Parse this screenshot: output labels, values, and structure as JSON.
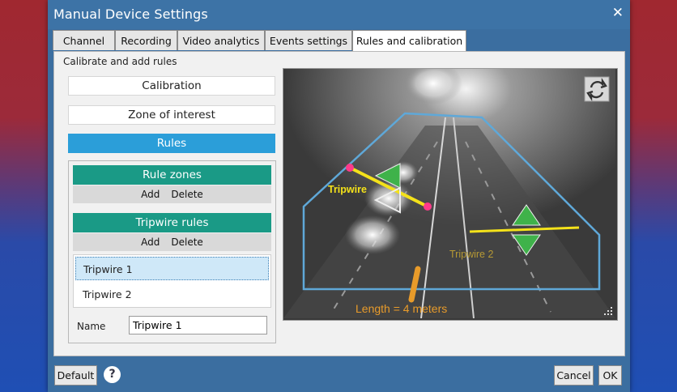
{
  "window": {
    "title": "Manual Device Settings",
    "close_glyph": "✕"
  },
  "tabs": [
    {
      "label": "Channel"
    },
    {
      "label": "Recording"
    },
    {
      "label": "Video analytics"
    },
    {
      "label": "Events settings"
    },
    {
      "label": "Rules and calibration",
      "active": true
    }
  ],
  "group_label": "Calibrate and add rules",
  "side_buttons": {
    "calibration": "Calibration",
    "zone": "Zone of interest",
    "rules": "Rules"
  },
  "rule_zones": {
    "header": "Rule zones",
    "add": "Add",
    "delete": "Delete"
  },
  "tripwire_rules": {
    "header": "Tripwire rules",
    "add": "Add",
    "delete": "Delete",
    "items": [
      {
        "label": "Tripwire 1",
        "selected": true
      },
      {
        "label": "Tripwire 2",
        "selected": false
      }
    ]
  },
  "name_field": {
    "label": "Name",
    "value": "Tripwire 1"
  },
  "video": {
    "tripwire1_label": "Tripwire",
    "tripwire2_label": "Tripwire 2",
    "length_label": "Length = 4 meters",
    "toggle_icon": "swap-icon"
  },
  "footer": {
    "default": "Default",
    "help": "?",
    "cancel": "Cancel",
    "ok": "OK"
  },
  "colors": {
    "accent_blue": "#2b9ed9",
    "teal_header": "#1a9a86",
    "zone_outline": "#5fa8d8",
    "tripwire_yellow": "#f4e21a",
    "handle_pink": "#ff3a8a",
    "arrow_green": "#3fb24a",
    "length_orange": "#e89b2a"
  }
}
